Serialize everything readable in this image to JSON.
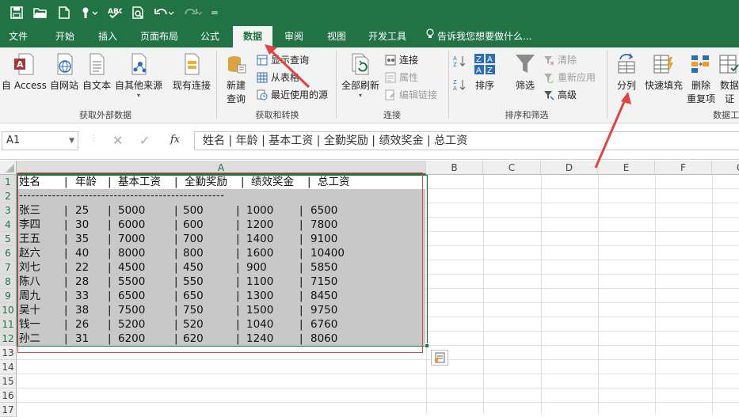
{
  "qat": {
    "customize": "="
  },
  "tabs": [
    {
      "label": "文件",
      "active": false
    },
    {
      "label": "开始",
      "active": false
    },
    {
      "label": "插入",
      "active": false
    },
    {
      "label": "页面布局",
      "active": false
    },
    {
      "label": "公式",
      "active": false
    },
    {
      "label": "数据",
      "active": true
    },
    {
      "label": "审阅",
      "active": false
    },
    {
      "label": "视图",
      "active": false
    },
    {
      "label": "开发工具",
      "active": false
    }
  ],
  "tell_me": "告诉我您想要做什么...",
  "ribbon": {
    "group_external": {
      "label": "获取外部数据",
      "buttons": [
        "自 Access",
        "自网站",
        "自文本",
        "自其他来源",
        "现有连接"
      ]
    },
    "group_transform": {
      "label": "获取和转换",
      "new_query": "新建\n查询",
      "new_query_l1": "新建",
      "new_query_l2": "查询",
      "show_query": "显示查询",
      "from_table": "从表格",
      "recent_sources": "最近使用的源"
    },
    "group_connections": {
      "label": "连接",
      "refresh_all": "全部刷新",
      "connections": "连接",
      "properties": "属性",
      "edit_links": "编辑链接"
    },
    "group_sort": {
      "label": "排序和筛选",
      "sort": "排序",
      "filter": "筛选",
      "clear": "清除",
      "reapply": "重新应用",
      "advanced": "高级"
    },
    "group_tools": {
      "label": "数据工",
      "text_to_columns": "分列",
      "flash_fill": "快速填充",
      "remove_dup_l1": "删除",
      "remove_dup_l2": "重复项",
      "validation_l1": "数据",
      "validation_l2": "证"
    }
  },
  "formula_bar": {
    "name_box": "A1",
    "fx": "fx",
    "content": "姓名  | 年龄 | 基本工资 | 全勤奖励 | 绩效奖金 | 总工资"
  },
  "columns": [
    "A",
    "B",
    "C",
    "D",
    "E",
    "F",
    "G"
  ],
  "rows": [
    "1",
    "2",
    "3",
    "4",
    "5",
    "6",
    "7",
    "8",
    "9",
    "10",
    "11",
    "12",
    "13",
    "14",
    "15",
    "16",
    "17"
  ],
  "sheet": {
    "header": [
      "姓名",
      "|",
      "年龄",
      "|",
      "基本工资",
      "|",
      "全勤奖励",
      "|",
      "绩效奖金",
      "|",
      "总工资"
    ],
    "divider": "--------------------------------------------------",
    "data": [
      [
        "张三",
        "|",
        "25",
        "|",
        "5000",
        "|",
        "500",
        "|",
        "1000",
        "|",
        "6500"
      ],
      [
        "李四",
        "|",
        "30",
        "|",
        "6000",
        "|",
        "600",
        "|",
        "1200",
        "|",
        "7800"
      ],
      [
        "王五",
        "|",
        "35",
        "|",
        "7000",
        "|",
        "700",
        "|",
        "1400",
        "|",
        "9100"
      ],
      [
        "赵六",
        "|",
        "40",
        "|",
        "8000",
        "|",
        "800",
        "|",
        "1600",
        "|",
        "10400"
      ],
      [
        "刘七",
        "|",
        "22",
        "|",
        "4500",
        "|",
        "450",
        "|",
        "900",
        "|",
        "5850"
      ],
      [
        "陈八",
        "|",
        "28",
        "|",
        "5500",
        "|",
        "550",
        "|",
        "1100",
        "|",
        "7150"
      ],
      [
        "周九",
        "|",
        "33",
        "|",
        "6500",
        "|",
        "650",
        "|",
        "1300",
        "|",
        "8450"
      ],
      [
        "吴十",
        "|",
        "38",
        "|",
        "7500",
        "|",
        "750",
        "|",
        "1500",
        "|",
        "9750"
      ],
      [
        "钱一",
        "|",
        "26",
        "|",
        "5200",
        "|",
        "520",
        "|",
        "1040",
        "|",
        "6760"
      ],
      [
        "孙二",
        "|",
        "31",
        "|",
        "6200",
        "|",
        "620",
        "|",
        "1240",
        "|",
        "8060"
      ]
    ]
  },
  "colors": {
    "excel_green": "#217346",
    "annotation_red": "#e04343",
    "selection_gray": "#c8c8c8"
  }
}
